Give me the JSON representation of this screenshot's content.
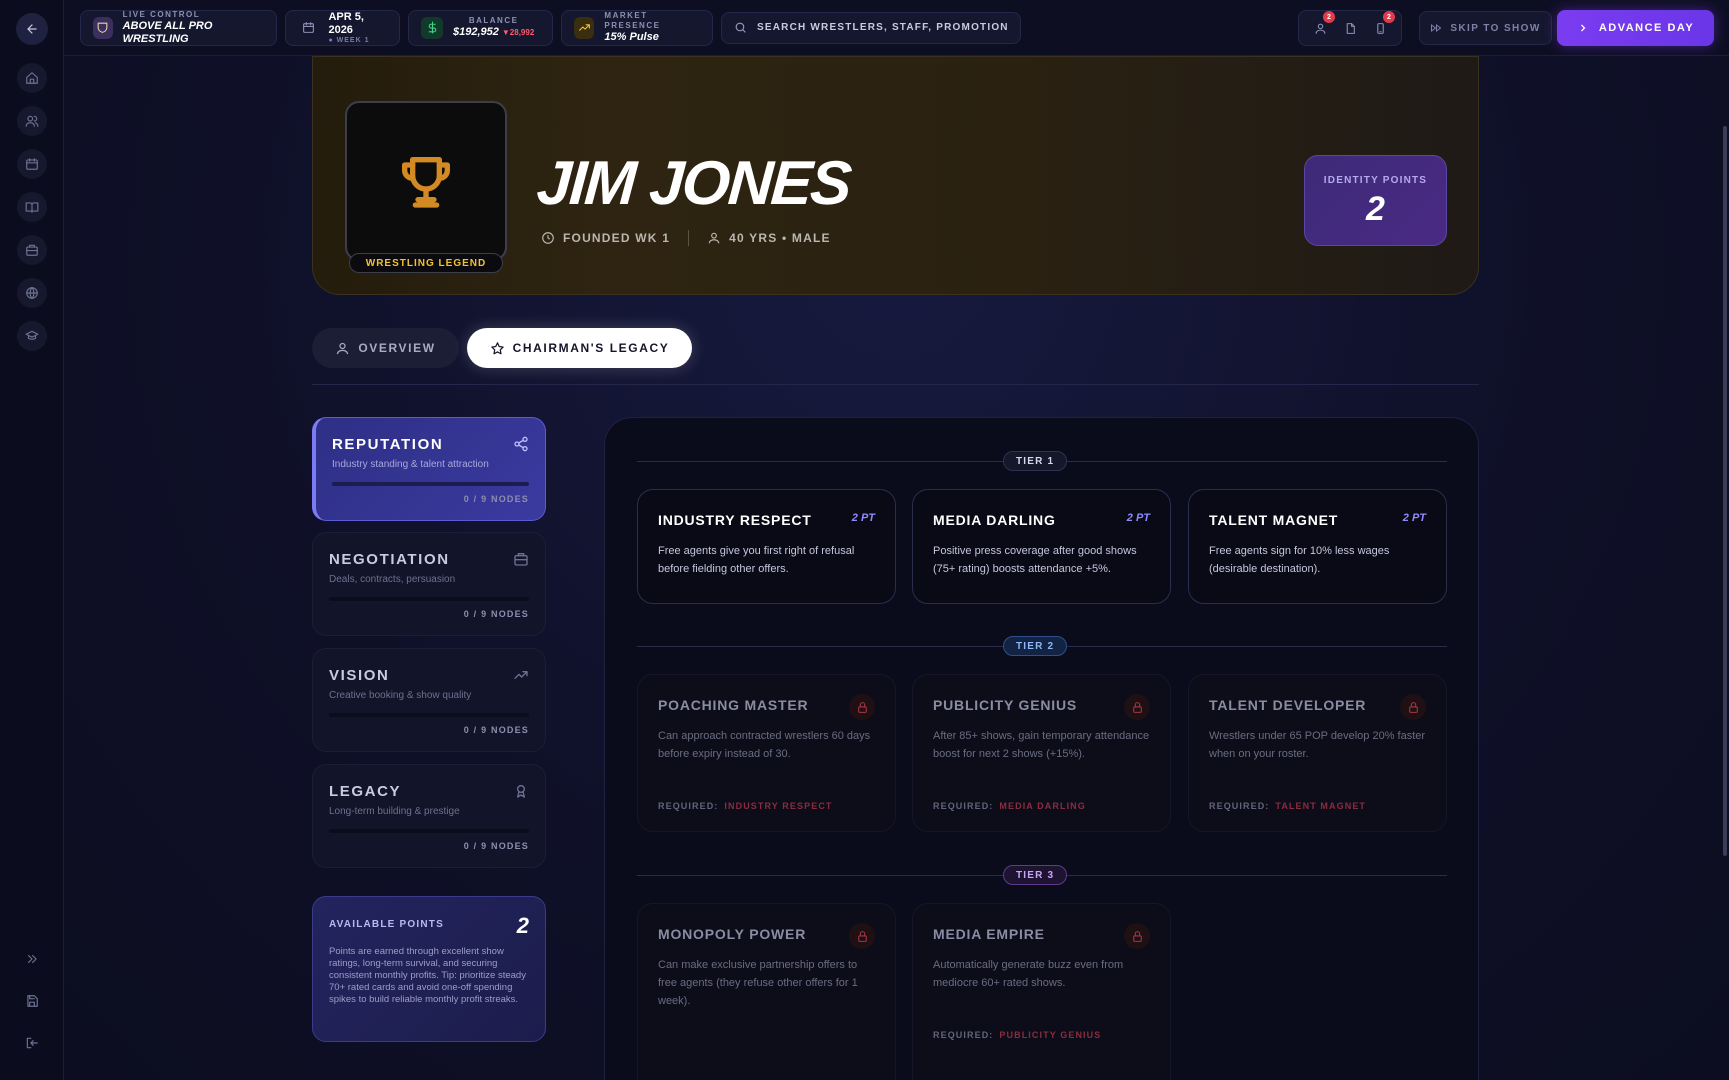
{
  "topbar": {
    "live_label": "LIVE CONTROL",
    "promotion_name": "ABOVE ALL PRO WRESTLING",
    "date": "APR 5, 2026",
    "week": "WEEK 1",
    "balance_label": "BALANCE",
    "balance_value": "$192,952",
    "balance_change": "▼28,992",
    "market_label": "MARKET PRESENCE",
    "market_value": "15% Pulse",
    "search_placeholder": "SEARCH WRESTLERS, STAFF, PROMOTIONS...",
    "badge_people": "2",
    "badge_phone": "2",
    "skip_label": "SKIP TO SHOW",
    "advance_label": "ADVANCE DAY"
  },
  "profile": {
    "name": "JIM JONES",
    "badge": "WRESTLING LEGEND",
    "founded": "FOUNDED WK 1",
    "age_gender": "40 YRS • MALE",
    "identity_label": "IDENTITY POINTS",
    "identity_value": "2"
  },
  "tabs": {
    "overview": "OVERVIEW",
    "legacy": "CHAIRMAN'S LEGACY"
  },
  "categories": [
    {
      "title": "REPUTATION",
      "desc": "Industry standing & talent attraction",
      "nodes": "0 / 9 NODES",
      "icon": "share-icon",
      "progress": 0
    },
    {
      "title": "NEGOTIATION",
      "desc": "Deals, contracts, persuasion",
      "nodes": "0 / 9 NODES",
      "icon": "briefcase-icon",
      "progress": 0
    },
    {
      "title": "VISION",
      "desc": "Creative booking & show quality",
      "nodes": "0 / 9 NODES",
      "icon": "trending-up-icon",
      "progress": 0
    },
    {
      "title": "LEGACY",
      "desc": "Long-term building & prestige",
      "nodes": "0 / 9 NODES",
      "icon": "award-icon",
      "progress": 0
    }
  ],
  "points": {
    "label": "AVAILABLE POINTS",
    "value": "2",
    "text": "Points are earned through excellent show ratings, long-term survival, and securing consistent monthly profits. Tip: prioritize steady 70+ rated cards and avoid one-off spending spikes to build reliable monthly profit streaks."
  },
  "tree": {
    "tier1": "TIER 1",
    "tier2": "TIER 2",
    "tier3": "TIER 3",
    "required_label": "REQUIRED:",
    "tier1_nodes": [
      {
        "title": "INDUSTRY RESPECT",
        "cost": "2 PT",
        "desc": "Free agents give you first right of refusal before fielding other offers."
      },
      {
        "title": "MEDIA DARLING",
        "cost": "2 PT",
        "desc": "Positive press coverage after good shows (75+ rating) boosts attendance +5%."
      },
      {
        "title": "TALENT MAGNET",
        "cost": "2 PT",
        "desc": "Free agents sign for 10% less wages (desirable destination)."
      }
    ],
    "tier2_nodes": [
      {
        "title": "POACHING MASTER",
        "desc": "Can approach contracted wrestlers 60 days before expiry instead of 30.",
        "required": "INDUSTRY RESPECT"
      },
      {
        "title": "PUBLICITY GENIUS",
        "desc": "After 85+ shows, gain temporary attendance boost for next 2 shows (+15%).",
        "required": "MEDIA DARLING"
      },
      {
        "title": "TALENT DEVELOPER",
        "desc": "Wrestlers under 65 POP develop 20% faster when on your roster.",
        "required": "TALENT MAGNET"
      }
    ],
    "tier3_nodes": [
      {
        "title": "MONOPOLY POWER",
        "desc": "Can make exclusive partnership offers to free agents (they refuse other offers for 1 week).",
        "required": ""
      },
      {
        "title": "MEDIA EMPIRE",
        "desc": "Automatically generate buzz even from mediocre 60+ rated shows.",
        "required": "PUBLICITY GENIUS"
      }
    ]
  },
  "colors": {
    "accent": "#7b3cf0",
    "gold": "#f1c232",
    "locked_red": "#a63446"
  }
}
